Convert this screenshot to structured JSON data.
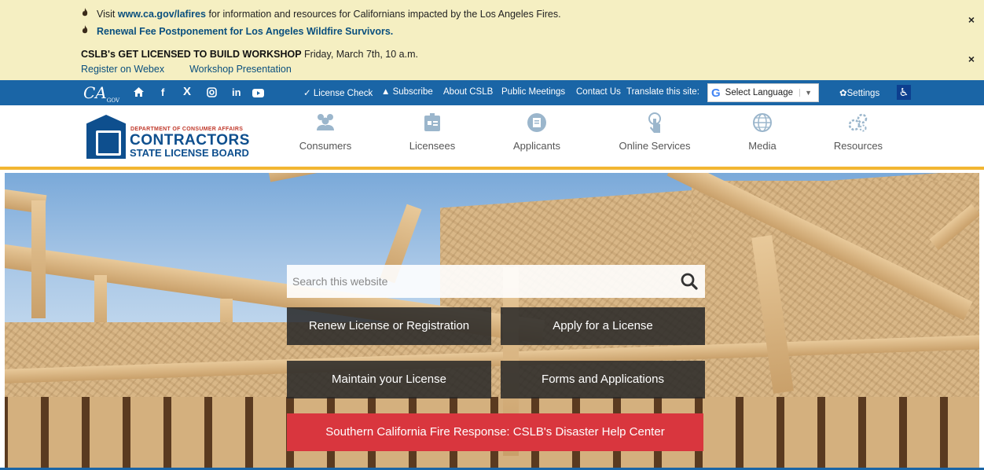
{
  "alerts": {
    "line1_prefix": "Visit ",
    "line1_link": "www.ca.gov/lafires",
    "line1_suffix": " for information and resources for Californians impacted by the Los Angeles Fires.",
    "line2": "Renewal Fee Postponement for Los Angeles Wildfire Survivors.",
    "workshop_title": "CSLB's GET LICENSED TO BUILD WORKSHOP",
    "workshop_when": " Friday, March 7th, 10 a.m.",
    "register_link": "Register on Webex",
    "presentation_link": "Workshop Presentation",
    "close_label": "×"
  },
  "utility": {
    "ca_logo": "CA",
    "ca_logo_sub": "GOV",
    "social": [
      "f",
      "X",
      "in"
    ],
    "links": {
      "license_check": "✓ License Check",
      "subscribe": "Subscribe",
      "about": "About CSLB",
      "meetings": "Public Meetings",
      "contact": "Contact Us",
      "translate": "Translate this site:"
    },
    "language_select": "Select Language",
    "settings": "Settings"
  },
  "header": {
    "logo_line1": "DEPARTMENT OF CONSUMER AFFAIRS",
    "logo_line2": "CONTRACTORS",
    "logo_line3": "STATE LICENSE BOARD",
    "nav": [
      {
        "label": "Consumers"
      },
      {
        "label": "Licensees"
      },
      {
        "label": "Applicants"
      },
      {
        "label": "Online Services"
      },
      {
        "label": "Media"
      },
      {
        "label": "Resources"
      }
    ]
  },
  "hero": {
    "search_placeholder": "Search this website",
    "renew": "Renew License or Registration",
    "apply": "Apply for a License",
    "maintain": "Maintain your License",
    "forms": "Forms and Applications",
    "fire": "Southern California Fire Response: CSLB's Disaster Help Center"
  },
  "colors": {
    "banner_bg": "#f5efc2",
    "utility_bar": "#1a65a6",
    "header_accent": "#f2b632",
    "fire_button": "#d9363e"
  }
}
